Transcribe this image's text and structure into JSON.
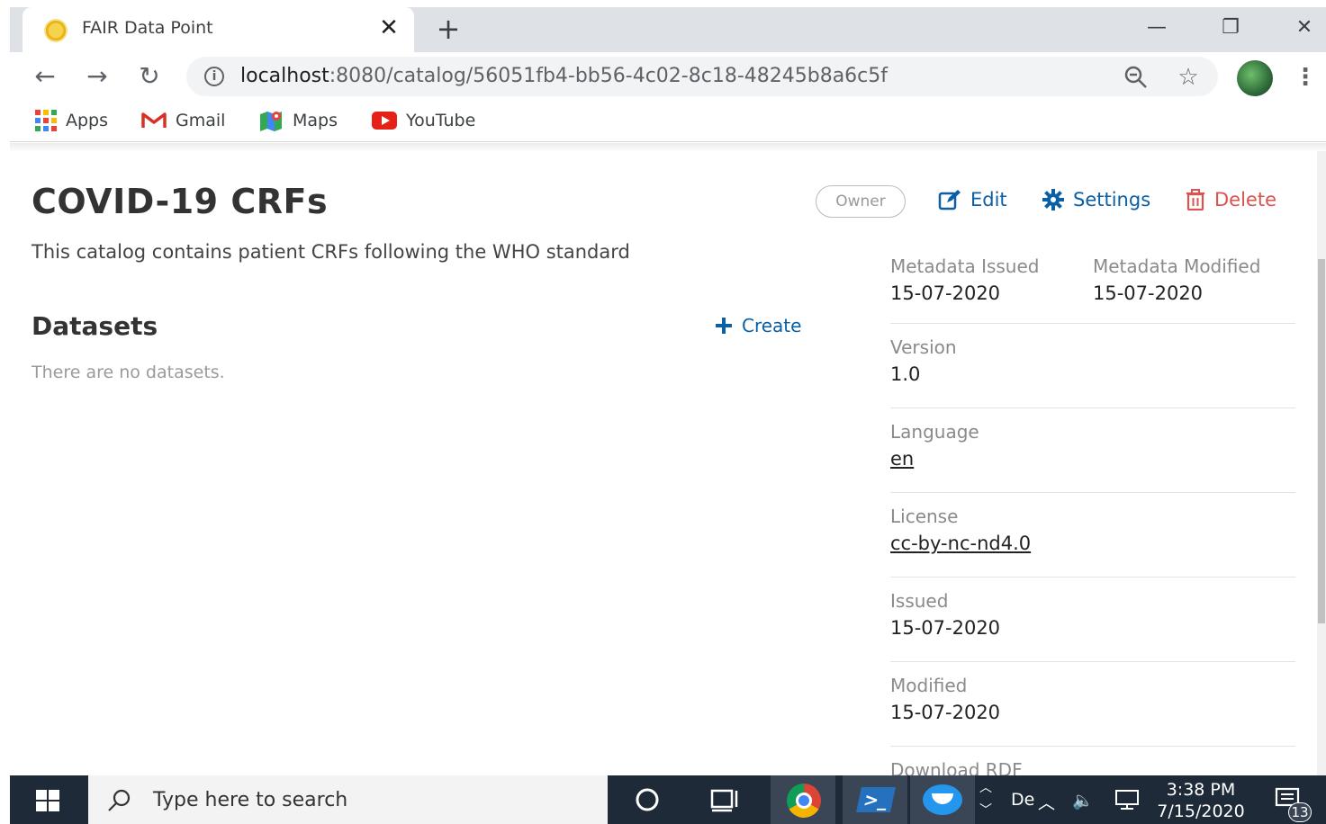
{
  "browser": {
    "tab": {
      "title": "FAIR Data Point",
      "close_label": "✕"
    },
    "new_tab_label": "+",
    "url_host": "localhost",
    "url_rest": ":8080/catalog/56051fb4-bb56-4c02-8c18-48245b8a6c5f",
    "bookmarks": [
      {
        "label": "Apps",
        "icon": "apps-grid-icon"
      },
      {
        "label": "Gmail",
        "icon": "gmail-icon"
      },
      {
        "label": "Maps",
        "icon": "maps-icon"
      },
      {
        "label": "YouTube",
        "icon": "youtube-icon"
      }
    ]
  },
  "page": {
    "title": "COVID-19 CRFs",
    "owner_badge": "Owner",
    "actions": {
      "edit": "Edit",
      "settings": "Settings",
      "delete": "Delete"
    },
    "description": "This catalog contains patient CRFs following the WHO standard",
    "datasets": {
      "title": "Datasets",
      "create_label": "Create",
      "empty_message": "There are no datasets."
    },
    "metadata": {
      "metadata_issued_label": "Metadata Issued",
      "metadata_issued_value": "15-07-2020",
      "metadata_modified_label": "Metadata Modified",
      "metadata_modified_value": "15-07-2020",
      "version_label": "Version",
      "version_value": "1.0",
      "language_label": "Language",
      "language_value": "en",
      "license_label": "License",
      "license_value": "cc-by-nc-nd4.0",
      "issued_label": "Issued",
      "issued_value": "15-07-2020",
      "modified_label": "Modified",
      "modified_value": "15-07-2020",
      "download_label": "Download RDF"
    }
  },
  "taskbar": {
    "search_placeholder": "Type here to search",
    "tray_lang": "De",
    "time": "3:38 PM",
    "date": "7/15/2020",
    "notification_count": "13"
  },
  "colors": {
    "accent_blue": "#0b5fa5",
    "delete_red": "#d9534f",
    "taskbar_bg": "#1f2a38"
  }
}
